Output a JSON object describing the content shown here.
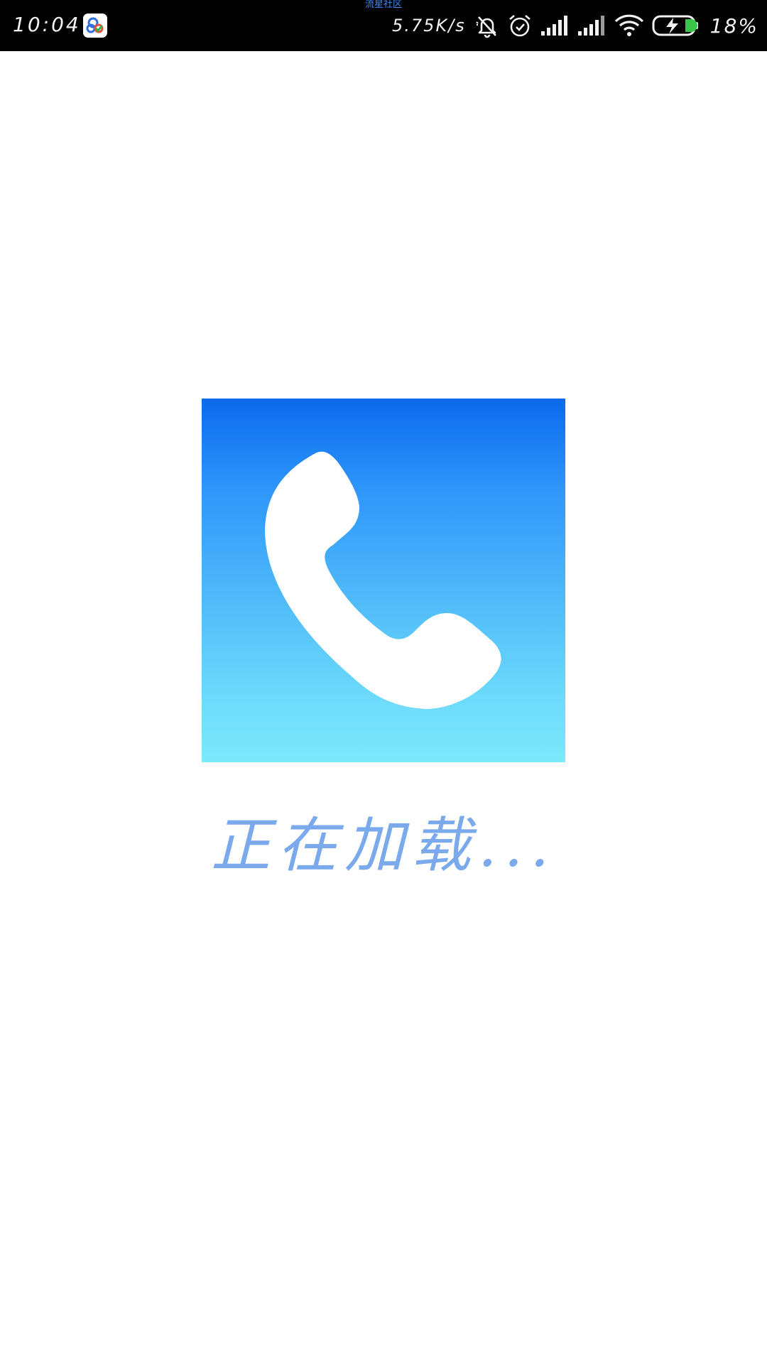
{
  "status_bar": {
    "watermark": "流星社区",
    "time": "10:04",
    "net_speed": "5.75K/s",
    "battery_percent": "18%",
    "icons": {
      "notification_app": "baidu-cloud-icon",
      "silent": "bell-off-icon",
      "alarm": "alarm-clock-icon",
      "signal_1": "signal-bars-icon",
      "signal_2": "signal-bars-icon",
      "wifi": "wifi-icon",
      "battery": "battery-charging-icon"
    }
  },
  "splash": {
    "logo_icon": "phone-handset-icon",
    "loading_text": "正在加载...",
    "colors": {
      "gradient_top": "#0a6aec",
      "gradient_bottom": "#7de9fc",
      "loading_text": "#7aa9ec"
    }
  }
}
